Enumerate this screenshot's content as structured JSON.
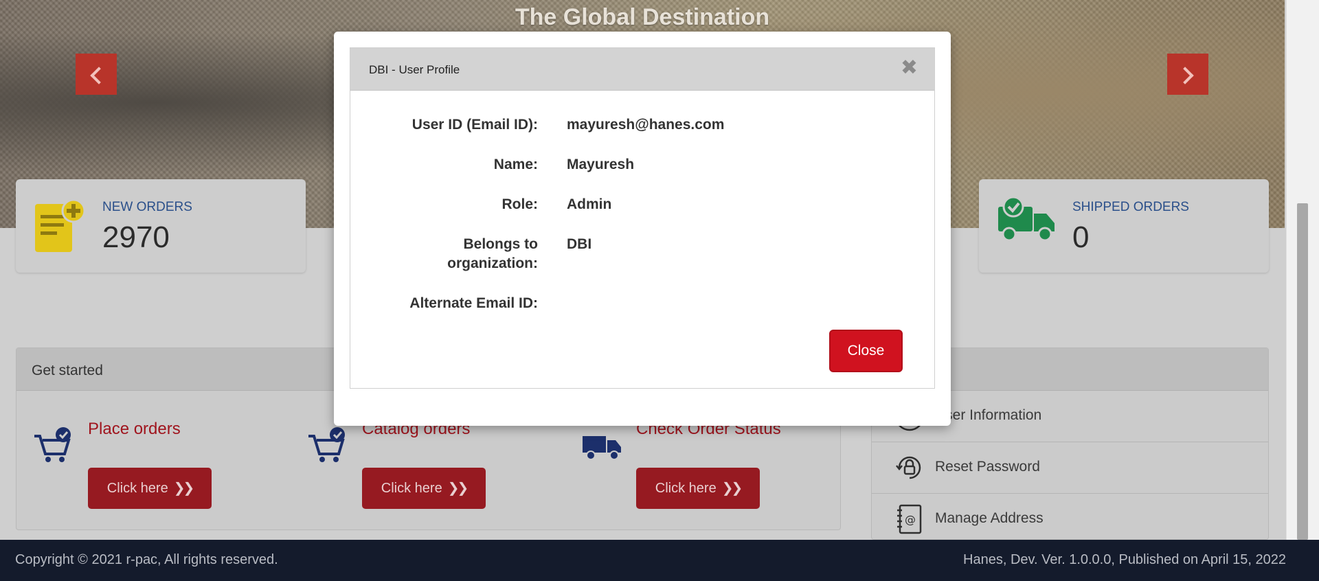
{
  "hero": {
    "title": "The Global Destination"
  },
  "stats": {
    "new_orders": {
      "label": "NEW ORDERS",
      "value": "2970"
    },
    "shipped_orders": {
      "label": "SHIPPED ORDERS",
      "value": "0"
    }
  },
  "get_started": {
    "header": "Get started",
    "items": [
      {
        "title": "Place orders",
        "button": "Click here",
        "icon": "cart-check-icon"
      },
      {
        "title": "Catalog orders",
        "button": "Click here",
        "icon": "cart-check-icon"
      },
      {
        "title": "Check Order Status",
        "button": "Click here",
        "icon": "delivery-truck-icon"
      }
    ]
  },
  "side_menu": {
    "items": [
      {
        "label": "User Information",
        "icon": "user-icon"
      },
      {
        "label": "Reset Password",
        "icon": "lock-reset-icon"
      },
      {
        "label": "Manage Address",
        "icon": "address-book-icon"
      }
    ]
  },
  "footer": {
    "copyright": "Copyright © 2021 r-pac, All rights reserved.",
    "version": "Hanes, Dev. Ver. 1.0.0.0, Published on April 15, 2022"
  },
  "modal": {
    "title": "DBI - User Profile",
    "close_x": "✖",
    "fields": [
      {
        "label": "User ID (Email ID):",
        "value": "mayuresh@hanes.com"
      },
      {
        "label": "Name:",
        "value": "Mayuresh"
      },
      {
        "label": "Role:",
        "value": "Admin"
      },
      {
        "label": "Belongs to organization:",
        "value": "DBI"
      },
      {
        "label": "Alternate Email ID:",
        "value": ""
      }
    ],
    "close_button": "Close"
  },
  "colors": {
    "accent_red": "#d0121f",
    "link_blue": "#2a4f8a",
    "footer_bg": "#141b2c"
  }
}
